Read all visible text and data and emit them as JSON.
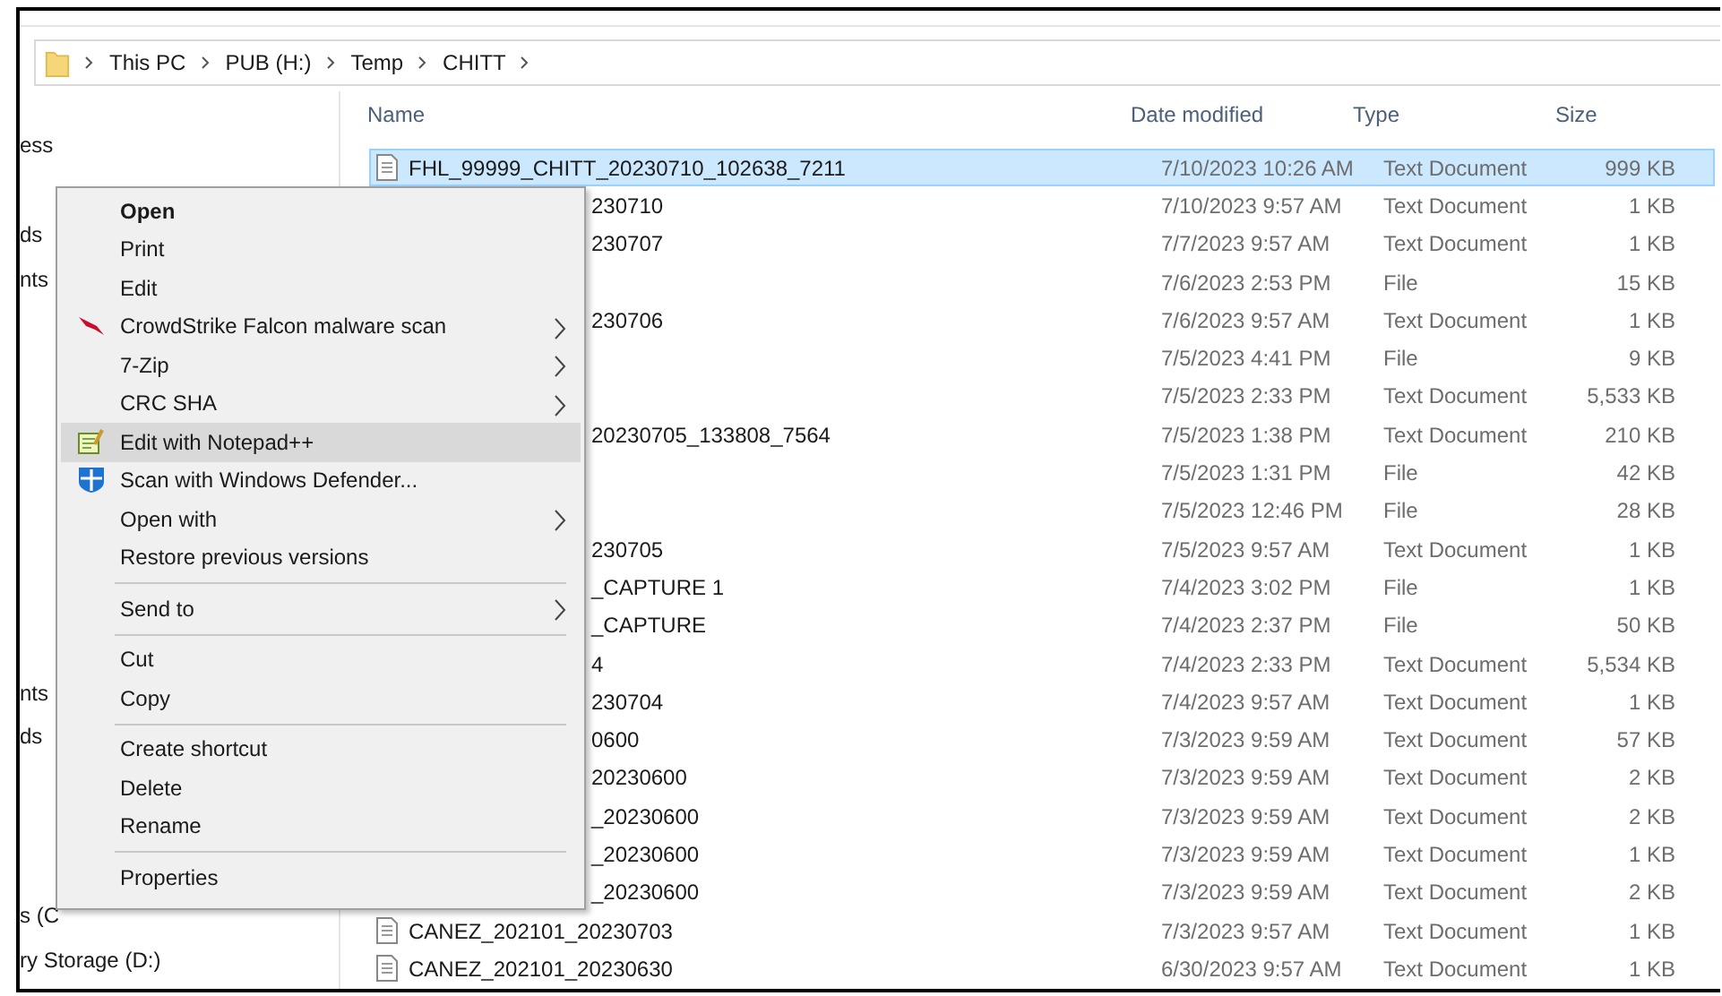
{
  "breadcrumb": [
    "This PC",
    "PUB (H:)",
    "Temp",
    "CHITT"
  ],
  "sidebar": {
    "items": [
      "ess",
      "ds",
      "nts",
      "nts",
      "ds",
      "s (C",
      "ry Storage (D:)"
    ]
  },
  "table": {
    "columns": [
      "Name",
      "Date modified",
      "Type",
      "Size"
    ],
    "rows": [
      {
        "kind": "full",
        "name": "FHL_99999_CHITT_20230710_102638_7211",
        "date": "7/10/2023 10:26 AM",
        "type": "Text Document",
        "size": "999 KB",
        "selected": true
      },
      {
        "kind": "partial",
        "name": "230710",
        "date": "7/10/2023 9:57 AM",
        "type": "Text Document",
        "size": "1 KB",
        "selected": false
      },
      {
        "kind": "partial",
        "name": "230707",
        "date": "7/7/2023 9:57 AM",
        "type": "Text Document",
        "size": "1 KB",
        "selected": false
      },
      {
        "kind": "hidden",
        "date": "7/6/2023 2:53 PM",
        "type": "File",
        "size": "15 KB",
        "selected": false
      },
      {
        "kind": "partial",
        "name": "230706",
        "date": "7/6/2023 9:57 AM",
        "type": "Text Document",
        "size": "1 KB",
        "selected": false
      },
      {
        "kind": "hidden",
        "date": "7/5/2023 4:41 PM",
        "type": "File",
        "size": "9 KB",
        "selected": false
      },
      {
        "kind": "hidden",
        "date": "7/5/2023 2:33 PM",
        "type": "Text Document",
        "size": "5,533 KB",
        "selected": false
      },
      {
        "kind": "partial",
        "name": "20230705_133808_7564",
        "date": "7/5/2023 1:38 PM",
        "type": "Text Document",
        "size": "210 KB",
        "selected": false
      },
      {
        "kind": "hidden",
        "date": "7/5/2023 1:31 PM",
        "type": "File",
        "size": "42 KB",
        "selected": false
      },
      {
        "kind": "hidden",
        "date": "7/5/2023 12:46 PM",
        "type": "File",
        "size": "28 KB",
        "selected": false
      },
      {
        "kind": "partial",
        "name": "230705",
        "date": "7/5/2023 9:57 AM",
        "type": "Text Document",
        "size": "1 KB",
        "selected": false
      },
      {
        "kind": "partial",
        "name": "_CAPTURE 1",
        "date": "7/4/2023 3:02 PM",
        "type": "File",
        "size": "1 KB",
        "selected": false
      },
      {
        "kind": "partial",
        "name": "_CAPTURE",
        "date": "7/4/2023 2:37 PM",
        "type": "File",
        "size": "50 KB",
        "selected": false
      },
      {
        "kind": "partial",
        "name": "4",
        "date": "7/4/2023 2:33 PM",
        "type": "Text Document",
        "size": "5,534 KB",
        "selected": false
      },
      {
        "kind": "partial",
        "name": "230704",
        "date": "7/4/2023 9:57 AM",
        "type": "Text Document",
        "size": "1 KB",
        "selected": false
      },
      {
        "kind": "partial",
        "name": "0600",
        "date": "7/3/2023 9:59 AM",
        "type": "Text Document",
        "size": "57 KB",
        "selected": false
      },
      {
        "kind": "partial",
        "name": "20230600",
        "date": "7/3/2023 9:59 AM",
        "type": "Text Document",
        "size": "2 KB",
        "selected": false
      },
      {
        "kind": "partial",
        "name": "_20230600",
        "date": "7/3/2023 9:59 AM",
        "type": "Text Document",
        "size": "2 KB",
        "selected": false
      },
      {
        "kind": "partial",
        "name": "_20230600",
        "date": "7/3/2023 9:59 AM",
        "type": "Text Document",
        "size": "1 KB",
        "selected": false
      },
      {
        "kind": "partial",
        "name": "_20230600",
        "date": "7/3/2023 9:59 AM",
        "type": "Text Document",
        "size": "2 KB",
        "selected": false
      },
      {
        "kind": "full",
        "name": "CANEZ_202101_20230703",
        "date": "7/3/2023 9:57 AM",
        "type": "Text Document",
        "size": "1 KB",
        "selected": false
      },
      {
        "kind": "full",
        "name": "CANEZ_202101_20230630",
        "date": "6/30/2023 9:57 AM",
        "type": "Text Document",
        "size": "1 KB",
        "selected": false
      }
    ]
  },
  "context_menu": {
    "items": [
      {
        "kind": "item",
        "label": "Open",
        "bold": true,
        "selected": false
      },
      {
        "kind": "item",
        "label": "Print",
        "selected": false
      },
      {
        "kind": "item",
        "label": "Edit",
        "selected": false
      },
      {
        "kind": "falcon",
        "label": "CrowdStrike Falcon malware scan",
        "submenu": true,
        "selected": false
      },
      {
        "kind": "item",
        "label": "7-Zip",
        "submenu": true,
        "selected": false
      },
      {
        "kind": "item",
        "label": "CRC SHA",
        "submenu": true,
        "selected": false
      },
      {
        "kind": "notepad",
        "label": "Edit with Notepad++",
        "selected": true
      },
      {
        "kind": "shield",
        "label": "Scan with Windows Defender...",
        "selected": false
      },
      {
        "kind": "item",
        "label": "Open with",
        "submenu": true,
        "selected": false
      },
      {
        "kind": "item",
        "label": "Restore previous versions",
        "selected": false
      },
      {
        "kind": "separator"
      },
      {
        "kind": "item",
        "label": "Send to",
        "submenu": true,
        "selected": false
      },
      {
        "kind": "separator"
      },
      {
        "kind": "item",
        "label": "Cut",
        "selected": false
      },
      {
        "kind": "item",
        "label": "Copy",
        "selected": false
      },
      {
        "kind": "separator"
      },
      {
        "kind": "item",
        "label": "Create shortcut",
        "selected": false
      },
      {
        "kind": "item",
        "label": "Delete",
        "selected": false
      },
      {
        "kind": "item",
        "label": "Rename",
        "selected": false
      },
      {
        "kind": "separator"
      },
      {
        "kind": "item",
        "label": "Properties",
        "selected": false
      }
    ]
  }
}
